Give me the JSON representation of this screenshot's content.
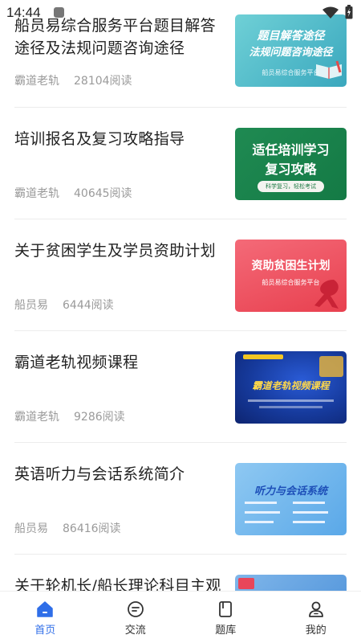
{
  "status_bar": {
    "time": "14:44"
  },
  "articles": [
    {
      "title": "船员易综合服务平台题目解答途径及法规问题咨询途径",
      "author": "霸道老轨",
      "views": "28104阅读",
      "thumb": {
        "line1": "题目解答途径",
        "line2": "法规问题咨询途径",
        "caption": "船员易综合服务平台"
      }
    },
    {
      "title": "培训报名及复习攻略指导",
      "author": "霸道老轨",
      "views": "40645阅读",
      "thumb": {
        "line1": "适任培训学习",
        "line2": "复习攻略",
        "caption": "科学复习，轻松考试"
      }
    },
    {
      "title": "关于贫困学生及学员资助计划",
      "author": "船员易",
      "views": "6444阅读",
      "thumb": {
        "line1": "资助贫困生计划",
        "caption": "船员易综合服务平台"
      }
    },
    {
      "title": "霸道老轨视频课程",
      "author": "霸道老轨",
      "views": "9286阅读",
      "thumb": {
        "line1": "霸道老轨视频课程"
      }
    },
    {
      "title": "英语听力与会话系统简介",
      "author": "船员易",
      "views": "86416阅读",
      "thumb": {
        "line1": "听力与会话系统"
      }
    },
    {
      "title": "关于轮机长/船长理论科目主观"
    }
  ],
  "tabbar": {
    "tabs": [
      {
        "label": "首页",
        "icon": "home-icon",
        "active": true
      },
      {
        "label": "交流",
        "icon": "chat-icon"
      },
      {
        "label": "题库",
        "icon": "book-icon"
      },
      {
        "label": "我的",
        "icon": "user-icon"
      }
    ],
    "active_color": "#2f6ee8"
  }
}
